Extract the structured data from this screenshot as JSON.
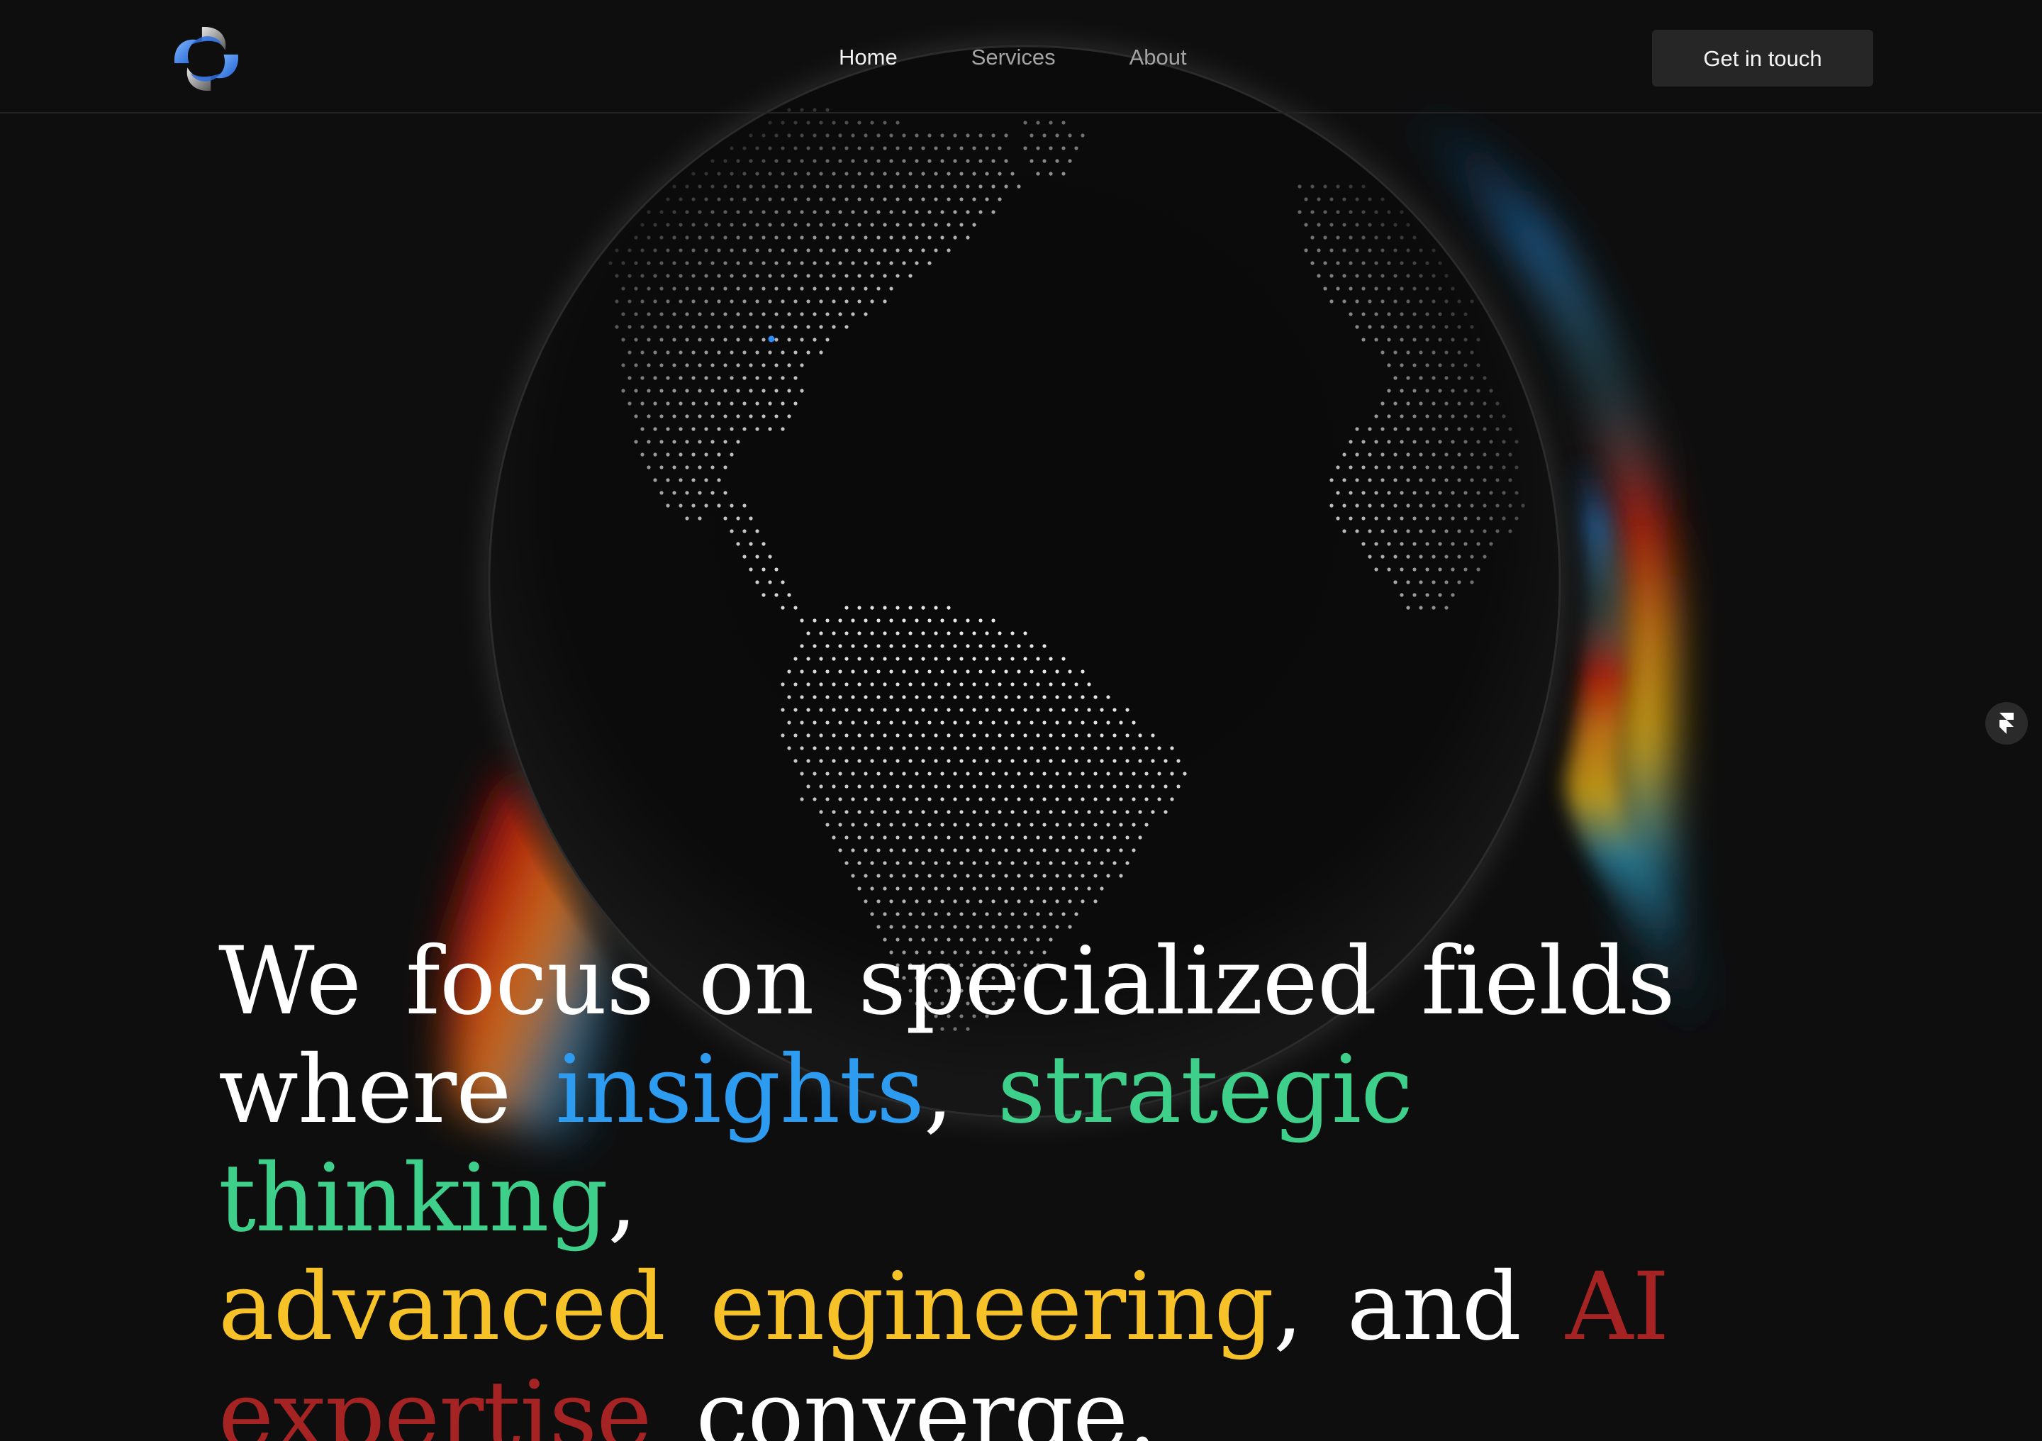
{
  "header": {
    "logo_icon": "swirl-logo-icon",
    "nav": [
      {
        "label": "Home",
        "active": true
      },
      {
        "label": "Services",
        "active": false
      },
      {
        "label": "About",
        "active": false
      }
    ],
    "cta_label": "Get in touch"
  },
  "hero": {
    "headline": {
      "line1": "We focus on specialized fields",
      "where": "where",
      "insights": "insights",
      "comma1": ",",
      "strategic_thinking": "strategic thinking",
      "comma2": ",",
      "advanced_engineering": "advanced engineering",
      "comma3": ",",
      "and": "and",
      "ai_expertise_1": "AI",
      "ai_expertise_2": "expertise",
      "converge": "converge."
    },
    "graphic": "dotted-globe-with-spectrum-glow"
  },
  "colors": {
    "background": "#0e0e0e",
    "insights": "#2d9cf0",
    "strategic_thinking": "#3ed08a",
    "advanced_engineering": "#f6c228",
    "ai_expertise": "#a52323"
  },
  "badge": {
    "icon": "framer-icon"
  }
}
